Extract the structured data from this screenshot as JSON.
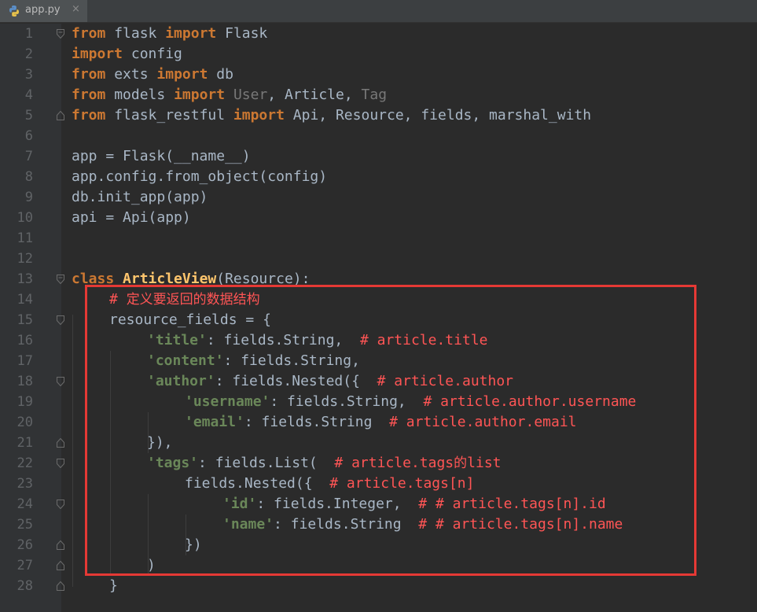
{
  "tab": {
    "filename": "app.py",
    "close": "×",
    "icon": "python-file-icon"
  },
  "colors": {
    "background": "#2b2b2b",
    "keyword": "#cc7832",
    "string": "#6a8759",
    "comment": "#ff5555",
    "function": "#ffc66d",
    "text": "#a9b7c6",
    "highlight_box": "#e53935"
  },
  "line_numbers": [
    "1",
    "2",
    "3",
    "4",
    "5",
    "6",
    "7",
    "8",
    "9",
    "10",
    "11",
    "12",
    "13",
    "14",
    "15",
    "16",
    "17",
    "18",
    "19",
    "20",
    "21",
    "22",
    "23",
    "24",
    "25",
    "26",
    "27",
    "28"
  ],
  "code": {
    "l1": {
      "a": "from",
      "b": " flask ",
      "c": "import",
      "d": " Flask"
    },
    "l2": {
      "a": "import",
      "b": " config"
    },
    "l3": {
      "a": "from",
      "b": " exts ",
      "c": "import",
      "d": " db"
    },
    "l4": {
      "a": "from",
      "b": " models ",
      "c": "import",
      "d": " ",
      "e": "User",
      "f": ", Article, ",
      "g": "Tag"
    },
    "l5": {
      "a": "from",
      "b": " flask_restful ",
      "c": "import",
      "d": " Api, Resource, fields, marshal_with"
    },
    "l7": {
      "a": "app = Flask(__name__)"
    },
    "l8": {
      "a": "app.config.from_object(config)"
    },
    "l9": {
      "a": "db.init_app(app)"
    },
    "l10": {
      "a": "api = Api(app)"
    },
    "l13": {
      "a": "class",
      "b": " ",
      "c": "ArticleView",
      "d": "(Resource):"
    },
    "l14": {
      "a": "# ",
      "b": "定义要返回的数据结构"
    },
    "l15": {
      "a": "resource_fields = {"
    },
    "l16": {
      "a": "'title'",
      "b": ": fields.String,  ",
      "c": "# article.title"
    },
    "l17": {
      "a": "'content'",
      "b": ": fields.String,"
    },
    "l18": {
      "a": "'author'",
      "b": ": fields.Nested({  ",
      "c": "# article.author"
    },
    "l19": {
      "a": "'username'",
      "b": ": fields.String,  ",
      "c": "# article.author.username"
    },
    "l20": {
      "a": "'email'",
      "b": ": fields.String  ",
      "c": "# article.author.email"
    },
    "l21": {
      "a": "}),"
    },
    "l22": {
      "a": "'tags'",
      "b": ": fields.List(  ",
      "c": "# article.tags",
      "d": "的",
      "e": "list"
    },
    "l23": {
      "a": "fields.Nested({  ",
      "b": "# article.tags[n]"
    },
    "l24": {
      "a": "'id'",
      "b": ": fields.Integer,  ",
      "c": "# # article.tags[n].id"
    },
    "l25": {
      "a": "'name'",
      "b": ": fields.String  ",
      "c": "# # article.tags[n].name"
    },
    "l26": {
      "a": "})"
    },
    "l27": {
      "a": ")"
    },
    "l28": {
      "a": "}"
    }
  }
}
